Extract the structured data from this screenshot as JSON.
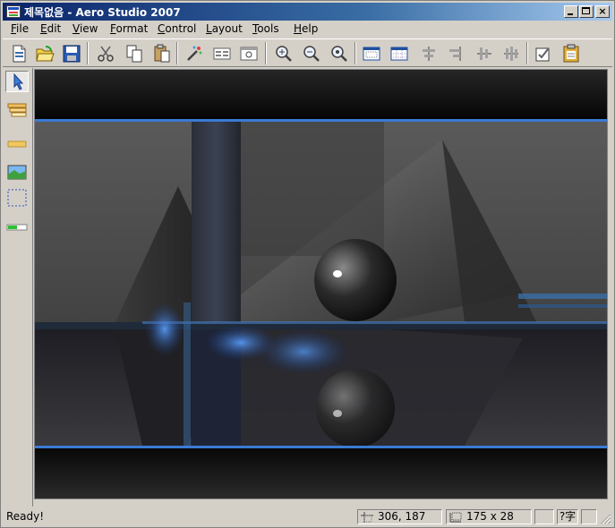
{
  "window": {
    "title": "제목없음 - Aero Studio 2007"
  },
  "menu": {
    "items": [
      {
        "label": "File",
        "accel": "F",
        "rest": "ile"
      },
      {
        "label": "Edit",
        "accel": "E",
        "rest": "dit"
      },
      {
        "label": "View",
        "accel": "V",
        "rest": "iew"
      },
      {
        "label": "Format",
        "accel": "F",
        "rest": "ormat"
      },
      {
        "label": "Control",
        "accel": "C",
        "rest": "ontrol"
      },
      {
        "label": "Layout",
        "accel": "L",
        "rest": "ayout"
      },
      {
        "label": "Tools",
        "accel": "T",
        "rest": "ools"
      },
      {
        "label": "Help",
        "accel": "H",
        "rest": "elp"
      }
    ]
  },
  "toolbar": {
    "tools": [
      "new-file-icon",
      "open-folder-icon",
      "save-disk-icon",
      "cut-scissors-icon",
      "copy-icon",
      "paste-icon",
      "magic-wand-icon",
      "properties-icon",
      "preview-icon",
      "zoom-icon",
      "zoom-in-icon",
      "zoom-out-icon",
      "window-frame-icon",
      "grid-icon",
      "align-left-icon",
      "align-right-icon",
      "align-vertical-icon",
      "align-distribute-icon",
      "settings-check-icon",
      "clipboard-icon"
    ]
  },
  "sidebar": {
    "tools": [
      "select-arrow-icon",
      "layers-icon",
      "bar-icon",
      "image-icon",
      "selection-box-icon",
      "progress-bar-icon"
    ]
  },
  "status": {
    "message": "Ready!",
    "position": "306, 187",
    "size": "175 x 28",
    "ime": "?字"
  },
  "colors": {
    "titlebar_start": "#0a246a",
    "titlebar_end": "#a6caf0",
    "accent_line": "#3a7bd5",
    "chrome": "#d4d0c8"
  }
}
